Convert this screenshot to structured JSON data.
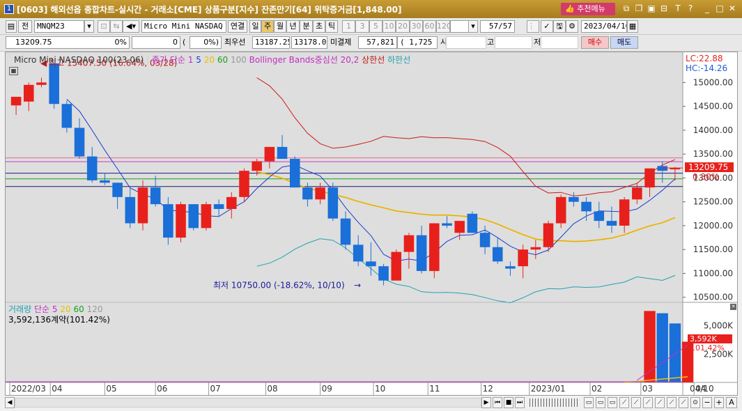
{
  "window": {
    "number": "1",
    "title": "[0603] 해외선옵 종합차트-실시간 - 거래소[CME] 상품구분[지수] 잔존만기[64] 위탁증거금[1,848.00]",
    "recommend_menu": "추천메뉴",
    "icons": [
      "link-icon",
      "copy-icon",
      "layout-icon",
      "text-icon",
      "help-icon",
      "minimize-icon",
      "restore-icon",
      "close-icon"
    ]
  },
  "toolbar1": {
    "prev_button": "전",
    "code": "MNQM23",
    "product_name": "Micro Mini NASDAQ 100",
    "link_button": "연결",
    "period_buttons": [
      "일",
      "주",
      "월",
      "년",
      "분",
      "초",
      "틱"
    ],
    "selected_period": "주",
    "interval_buttons": [
      "1",
      "3",
      "5",
      "10",
      "20",
      "30",
      "60",
      "120"
    ],
    "page_counter": "57/57",
    "date": "2023/04/10"
  },
  "toolbar2": {
    "price": "13209.75",
    "change_pct": "0%",
    "change": "0",
    "change_paren": "0%)",
    "best_ask_label": "최우선",
    "best_ask": "13187.25",
    "best_bid": "13178.00",
    "open_interest_label": "미결제",
    "open_interest": "57,821",
    "oi_change": "( 1,725 )",
    "open_label": "시",
    "high_label": "고",
    "low_label": "저",
    "buy_button": "매수",
    "sell_button": "매도"
  },
  "legend": {
    "title": "Micro Mini NASDAQ 100(23.06)",
    "ma_label": "종가 단순",
    "ma_periods": [
      "1",
      "5",
      "20",
      "60",
      "100"
    ],
    "bb_label": "Bollinger Bands중심선 20,2",
    "upper_label": "상한선",
    "lower_label": "하한선",
    "lc": "LC:22.88",
    "hc": "HC:-14.26"
  },
  "annotations": {
    "high": "최고 15407.50 (16.64%, 03/28)",
    "low": "최저 10750.00 (-18.62%, 10/10)",
    "current_price": "13209.75",
    "current_pct": "0.30%"
  },
  "volume_legend": {
    "title": "거래량",
    "ma_label": "단순",
    "ma_periods": [
      "5",
      "20",
      "60",
      "120"
    ],
    "value": "3,592,136계약(101.42%)",
    "badge": "3,592K",
    "badge_pct": "101.42%"
  },
  "x_axis_labels": [
    "2022/03",
    "04",
    "05",
    "06",
    "07",
    "08",
    "09",
    "10",
    "11",
    "12",
    "2023/01",
    "02",
    "03",
    "04"
  ],
  "x_axis_end": "04/10",
  "colors": {
    "up": "#e8201c",
    "down": "#1a6fd8",
    "ma5": "#1a3cd0",
    "ma20": "#f0c800",
    "bb_mid": "#c01818",
    "bb_upper": "#cc1818",
    "bb_lower": "#22a0b0"
  },
  "chart_data": {
    "type": "candlestick",
    "price_axis": {
      "ticks": [
        10500,
        11000,
        11500,
        12000,
        12500,
        13000,
        13500,
        14000,
        14500,
        15000
      ],
      "range": [
        10350,
        15400
      ]
    },
    "volume_axis": {
      "ticks": [
        "2,500K",
        "5,000K"
      ]
    },
    "candles": [
      {
        "o": 14520,
        "h": 14700,
        "l": 14320,
        "c": 14700
      },
      {
        "o": 14600,
        "h": 15000,
        "l": 14400,
        "c": 14950
      },
      {
        "o": 14950,
        "h": 15100,
        "l": 14900,
        "c": 15000
      },
      {
        "o": 15400,
        "h": 15407.5,
        "l": 14450,
        "c": 14550
      },
      {
        "o": 14550,
        "h": 14620,
        "l": 13950,
        "c": 14050
      },
      {
        "o": 14050,
        "h": 14250,
        "l": 13400,
        "c": 13450
      },
      {
        "o": 13450,
        "h": 13650,
        "l": 12900,
        "c": 12950
      },
      {
        "o": 12950,
        "h": 13100,
        "l": 12850,
        "c": 12900
      },
      {
        "o": 12900,
        "h": 12900,
        "l": 12350,
        "c": 12600
      },
      {
        "o": 12600,
        "h": 12800,
        "l": 11950,
        "c": 12050
      },
      {
        "o": 12050,
        "h": 12950,
        "l": 11900,
        "c": 12800
      },
      {
        "o": 12800,
        "h": 13050,
        "l": 12400,
        "c": 12450
      },
      {
        "o": 12450,
        "h": 12600,
        "l": 11600,
        "c": 11750
      },
      {
        "o": 11750,
        "h": 12500,
        "l": 11650,
        "c": 12450
      },
      {
        "o": 12450,
        "h": 12450,
        "l": 11900,
        "c": 11950
      },
      {
        "o": 11950,
        "h": 12500,
        "l": 11900,
        "c": 12450
      },
      {
        "o": 12450,
        "h": 12550,
        "l": 12200,
        "c": 12350
      },
      {
        "o": 12350,
        "h": 12700,
        "l": 12150,
        "c": 12600
      },
      {
        "o": 12600,
        "h": 13200,
        "l": 12500,
        "c": 13150
      },
      {
        "o": 13150,
        "h": 13400,
        "l": 13050,
        "c": 13350
      },
      {
        "o": 13350,
        "h": 13650,
        "l": 13200,
        "c": 13650
      },
      {
        "o": 13650,
        "h": 13900,
        "l": 13400,
        "c": 13400
      },
      {
        "o": 13400,
        "h": 13450,
        "l": 13000,
        "c": 12800
      },
      {
        "o": 12800,
        "h": 12900,
        "l": 12400,
        "c": 12550
      },
      {
        "o": 12550,
        "h": 12900,
        "l": 12450,
        "c": 12800
      },
      {
        "o": 12800,
        "h": 12900,
        "l": 12100,
        "c": 12150
      },
      {
        "o": 12150,
        "h": 12300,
        "l": 11500,
        "c": 11600
      },
      {
        "o": 11600,
        "h": 11800,
        "l": 11150,
        "c": 11250
      },
      {
        "o": 11250,
        "h": 11650,
        "l": 10950,
        "c": 11150
      },
      {
        "o": 11150,
        "h": 11200,
        "l": 10750,
        "c": 10850
      },
      {
        "o": 10850,
        "h": 11500,
        "l": 10850,
        "c": 11450
      },
      {
        "o": 11450,
        "h": 11850,
        "l": 11100,
        "c": 11800
      },
      {
        "o": 11800,
        "h": 12000,
        "l": 11000,
        "c": 11050
      },
      {
        "o": 11050,
        "h": 12000,
        "l": 10900,
        "c": 12050
      },
      {
        "o": 12050,
        "h": 12200,
        "l": 11950,
        "c": 12000
      },
      {
        "o": 11850,
        "h": 12050,
        "l": 11700,
        "c": 12100
      },
      {
        "o": 12250,
        "h": 12300,
        "l": 11850,
        "c": 11850
      },
      {
        "o": 11850,
        "h": 12000,
        "l": 11400,
        "c": 11550
      },
      {
        "o": 11550,
        "h": 11750,
        "l": 11200,
        "c": 11250
      },
      {
        "o": 11150,
        "h": 11250,
        "l": 10950,
        "c": 11100
      },
      {
        "o": 11150,
        "h": 11600,
        "l": 10900,
        "c": 11500
      },
      {
        "o": 11500,
        "h": 11700,
        "l": 11300,
        "c": 11550
      },
      {
        "o": 11550,
        "h": 12100,
        "l": 11450,
        "c": 12050
      },
      {
        "o": 12050,
        "h": 12650,
        "l": 11950,
        "c": 12600
      },
      {
        "o": 12600,
        "h": 12700,
        "l": 12400,
        "c": 12500
      },
      {
        "o": 12500,
        "h": 12600,
        "l": 12100,
        "c": 12300
      },
      {
        "o": 12300,
        "h": 12500,
        "l": 11950,
        "c": 12100
      },
      {
        "o": 12100,
        "h": 12400,
        "l": 11850,
        "c": 12000
      },
      {
        "o": 12000,
        "h": 12600,
        "l": 11850,
        "c": 12550
      },
      {
        "o": 12550,
        "h": 12900,
        "l": 12450,
        "c": 12800
      },
      {
        "o": 12800,
        "h": 13150,
        "l": 12600,
        "c": 13200
      },
      {
        "o": 13250,
        "h": 13350,
        "l": 12900,
        "c": 13150
      },
      {
        "o": 13180,
        "h": 13230,
        "l": 12950,
        "c": 13209.75
      }
    ],
    "first_visible_candle": 0,
    "volume_bars": [
      {
        "index": 49,
        "value": 0
      },
      {
        "index": 50,
        "value": 6300,
        "up": true
      },
      {
        "index": 51,
        "value": 6100,
        "up": false
      },
      {
        "index": 52,
        "value": 5200,
        "up": false
      },
      {
        "index": 53,
        "value": 3592,
        "up": true
      }
    ]
  }
}
